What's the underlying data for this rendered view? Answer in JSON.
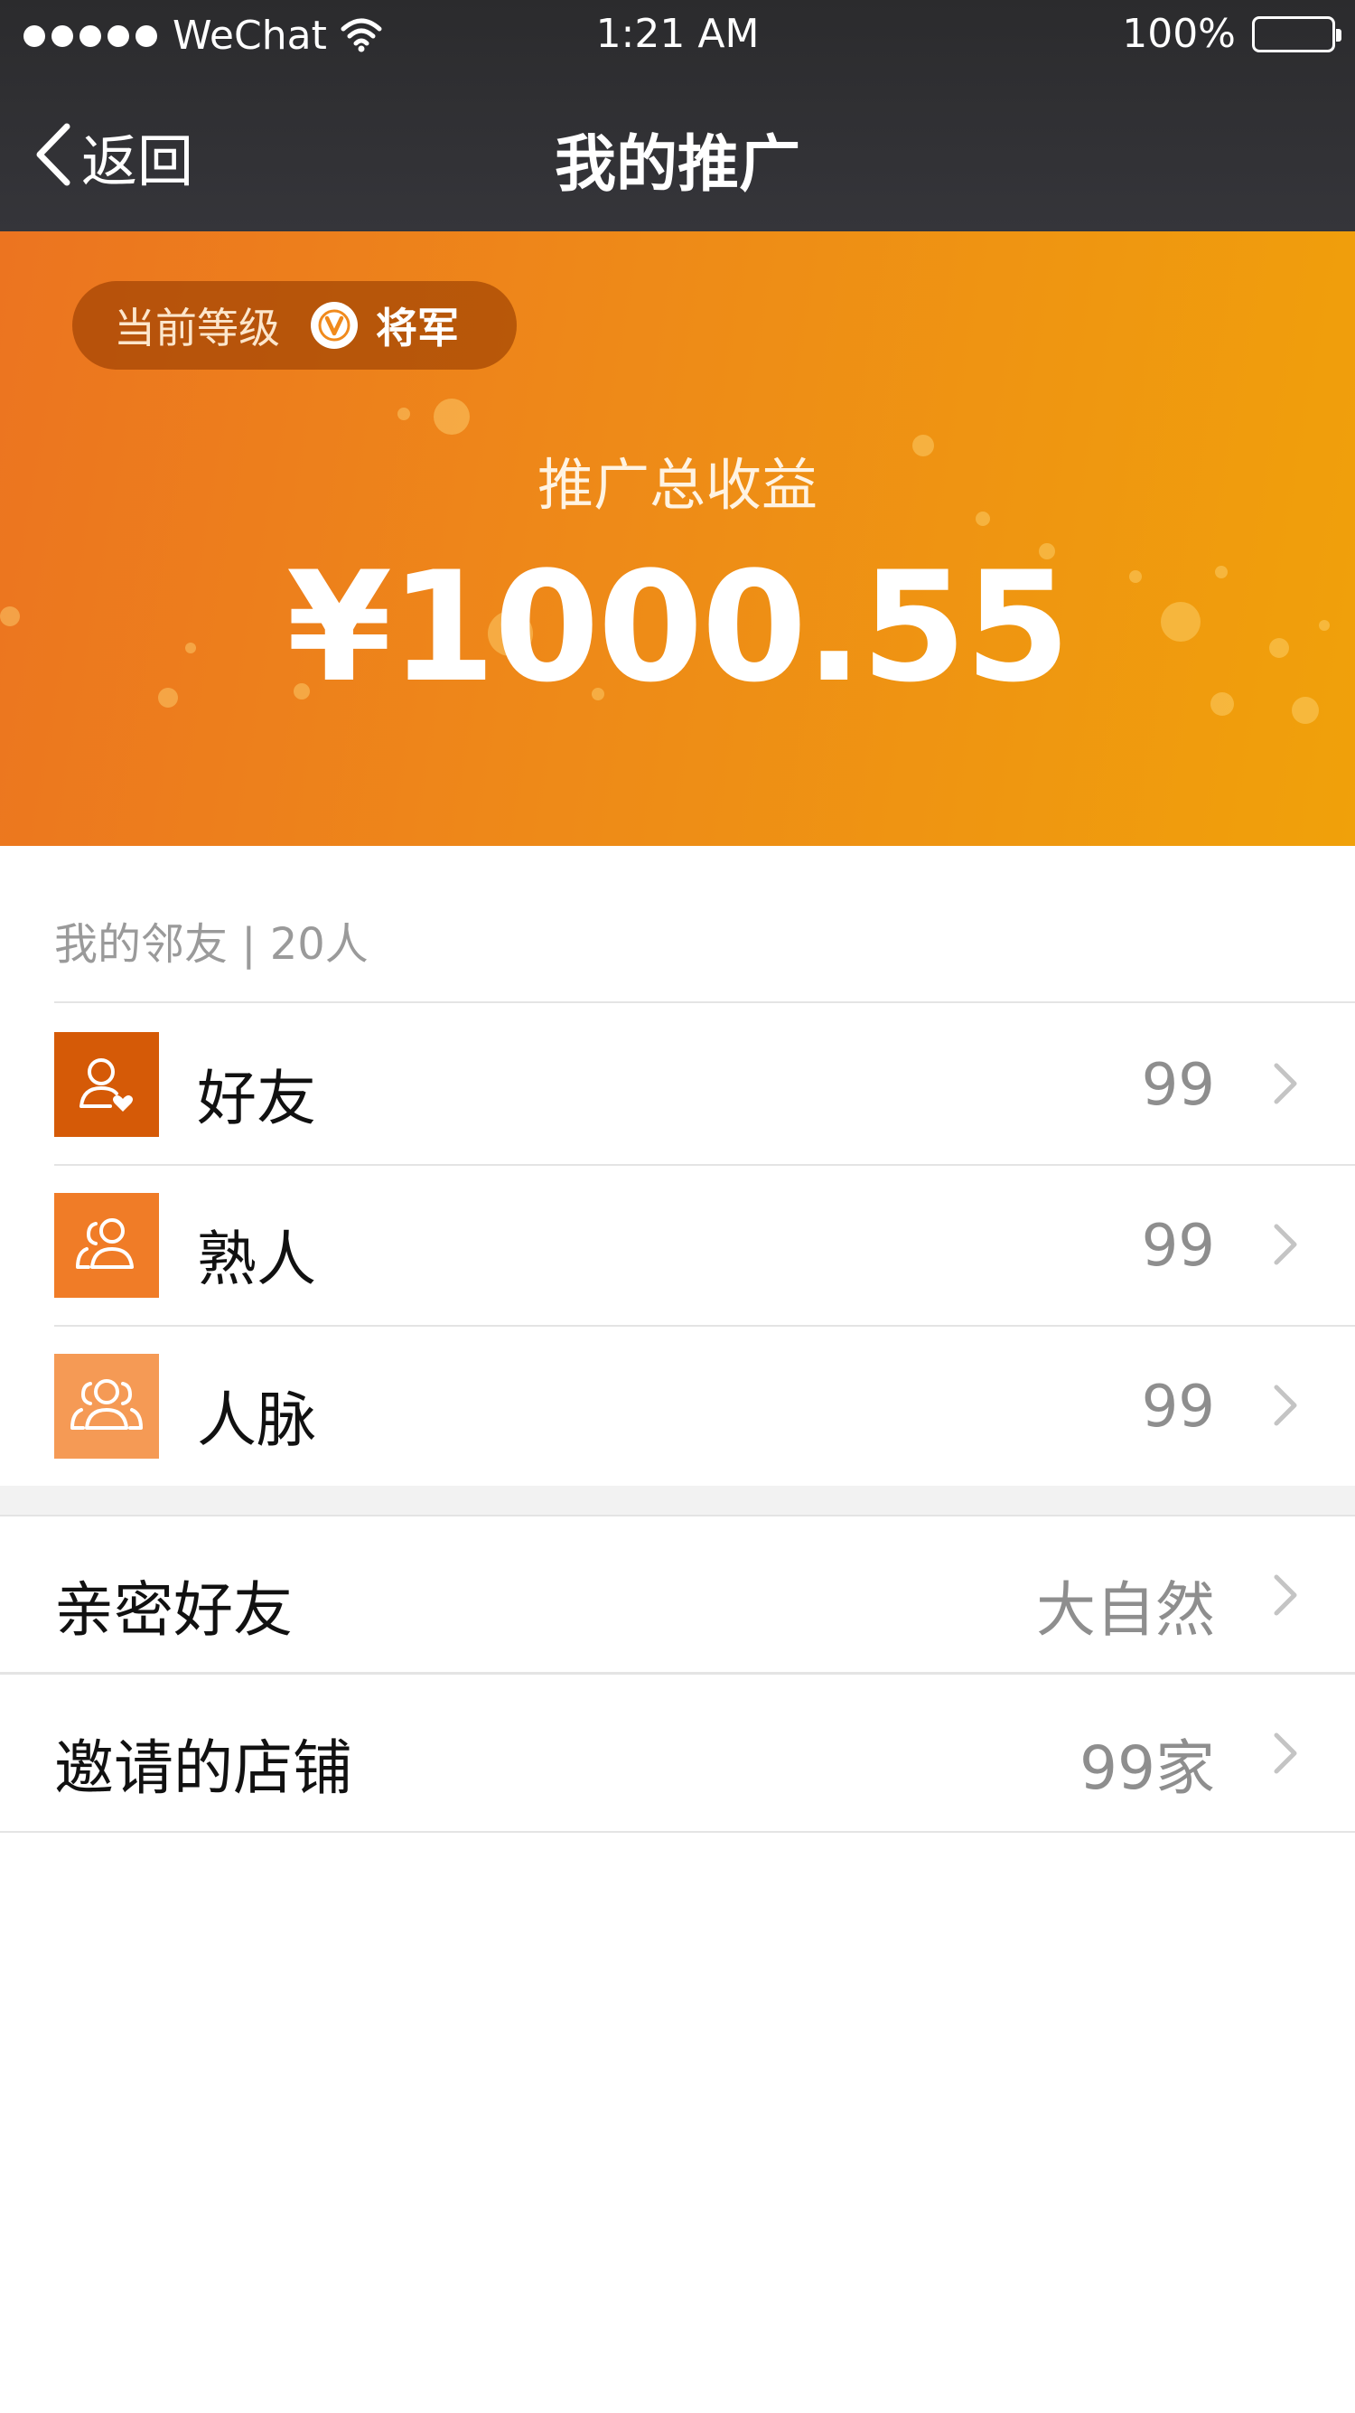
{
  "status_bar": {
    "carrier": "WeChat",
    "time": "1:21 AM",
    "battery": "100%"
  },
  "nav": {
    "back_label": "返回",
    "title": "我的推广"
  },
  "hero": {
    "level_label": "当前等级",
    "level_value": "将军",
    "earnings_label": "推广总收益",
    "earnings_amount": "¥1000.55"
  },
  "friends": {
    "header": "我的邻友 | 20人",
    "items": [
      {
        "label": "好友",
        "count": "99",
        "icon": "user-heart-icon",
        "color": "#d55a07"
      },
      {
        "label": "熟人",
        "count": "99",
        "icon": "two-users-icon",
        "color": "#f07c27"
      },
      {
        "label": "人脉",
        "count": "99",
        "icon": "three-users-icon",
        "color": "#f59a55"
      }
    ]
  },
  "extra": {
    "items": [
      {
        "label": "亲密好友",
        "value": "大自然"
      },
      {
        "label": "邀请的店铺",
        "value": "99家"
      }
    ]
  },
  "colors": {
    "nav_bg": "#323235",
    "hero_start": "#ec7420",
    "hero_end": "#f0a10a",
    "accent": "#f07c27"
  }
}
